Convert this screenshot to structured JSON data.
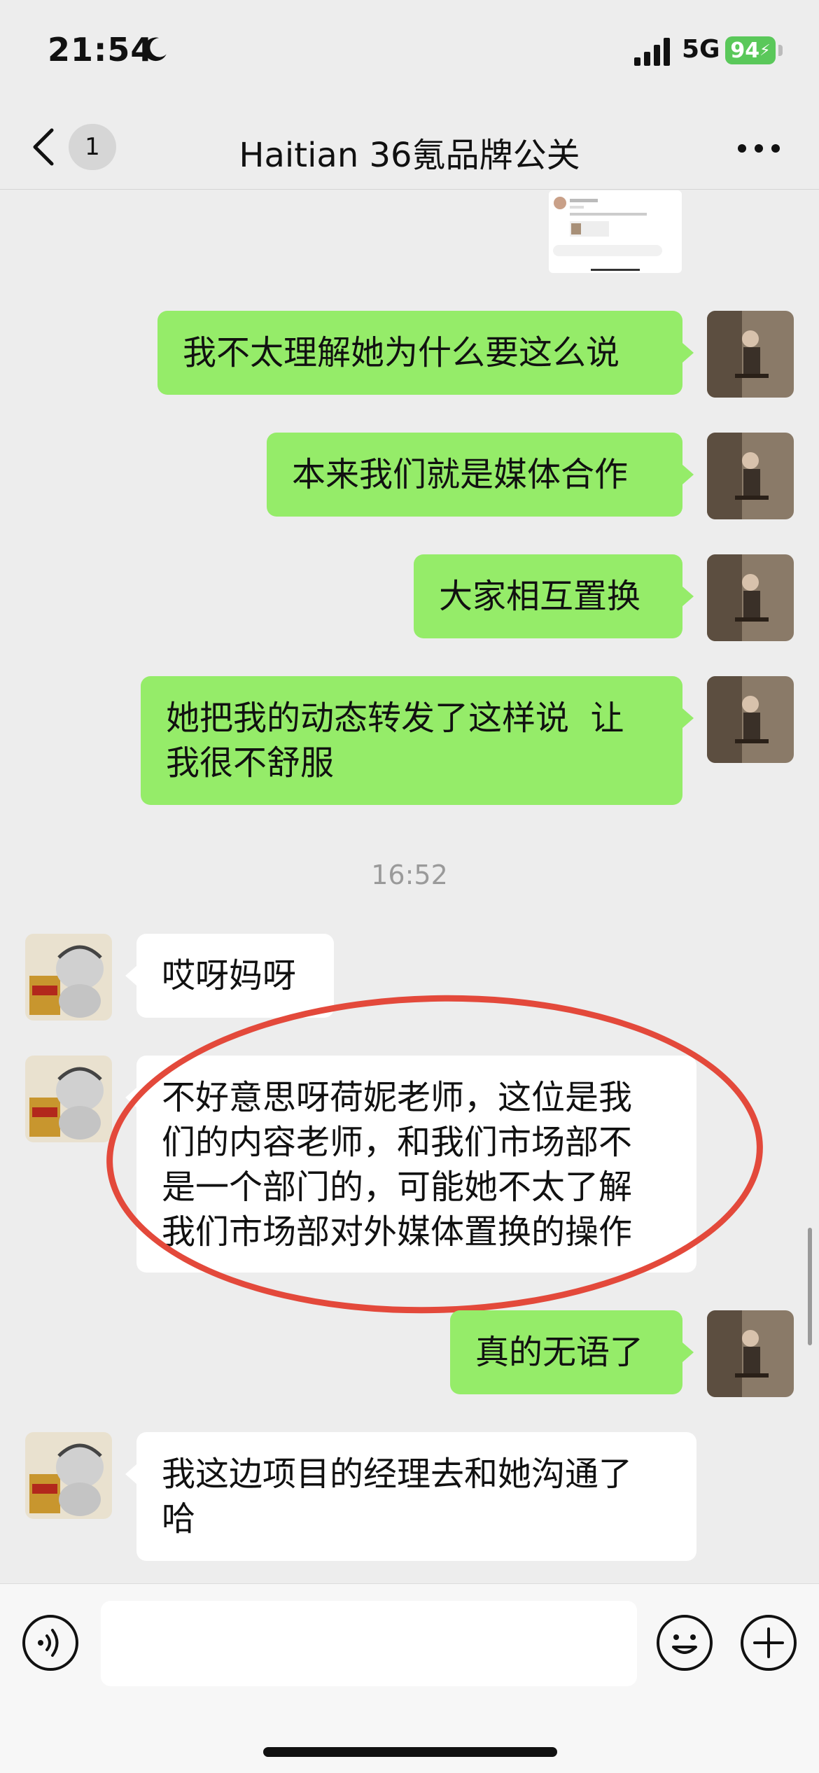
{
  "status_bar": {
    "time": "21:54",
    "network": "5G",
    "battery": "94"
  },
  "nav": {
    "back_badge": "1",
    "title": "Haitian 36氪品牌公关"
  },
  "colors": {
    "outgoing_bubble": "#95ec69",
    "incoming_bubble": "#ffffff",
    "annotation_circle": "#e3493b",
    "background": "#ededed"
  },
  "messages": [
    {
      "direction": "out",
      "lines": [
        "我不太理解她为什么要这么说"
      ]
    },
    {
      "direction": "out",
      "lines": [
        "本来我们就是媒体合作"
      ]
    },
    {
      "direction": "out",
      "lines": [
        "大家相互置换"
      ]
    },
    {
      "direction": "out",
      "lines": [
        "她把我的动态转发了这样说  让",
        "我很不舒服"
      ]
    },
    {
      "direction": "in",
      "lines": [
        "哎呀妈呀"
      ]
    },
    {
      "direction": "in",
      "lines": [
        "不好意思呀荷妮老师，这位是我",
        "们的内容老师，和我们市场部不",
        "是一个部门的，可能她不太了解",
        "我们市场部对外媒体置换的操作"
      ]
    },
    {
      "direction": "out",
      "lines": [
        "真的无语了"
      ]
    },
    {
      "direction": "in",
      "lines": [
        "我这边项目的经理去和她沟通了",
        "哈"
      ]
    }
  ],
  "timestamp": "16:52",
  "icons": {
    "moon": "moon-icon",
    "signal": "signal-icon",
    "back": "chevron-left-icon",
    "more": "more-icon",
    "voice": "voice-icon",
    "emoji": "emoji-icon",
    "plus": "plus-icon"
  }
}
